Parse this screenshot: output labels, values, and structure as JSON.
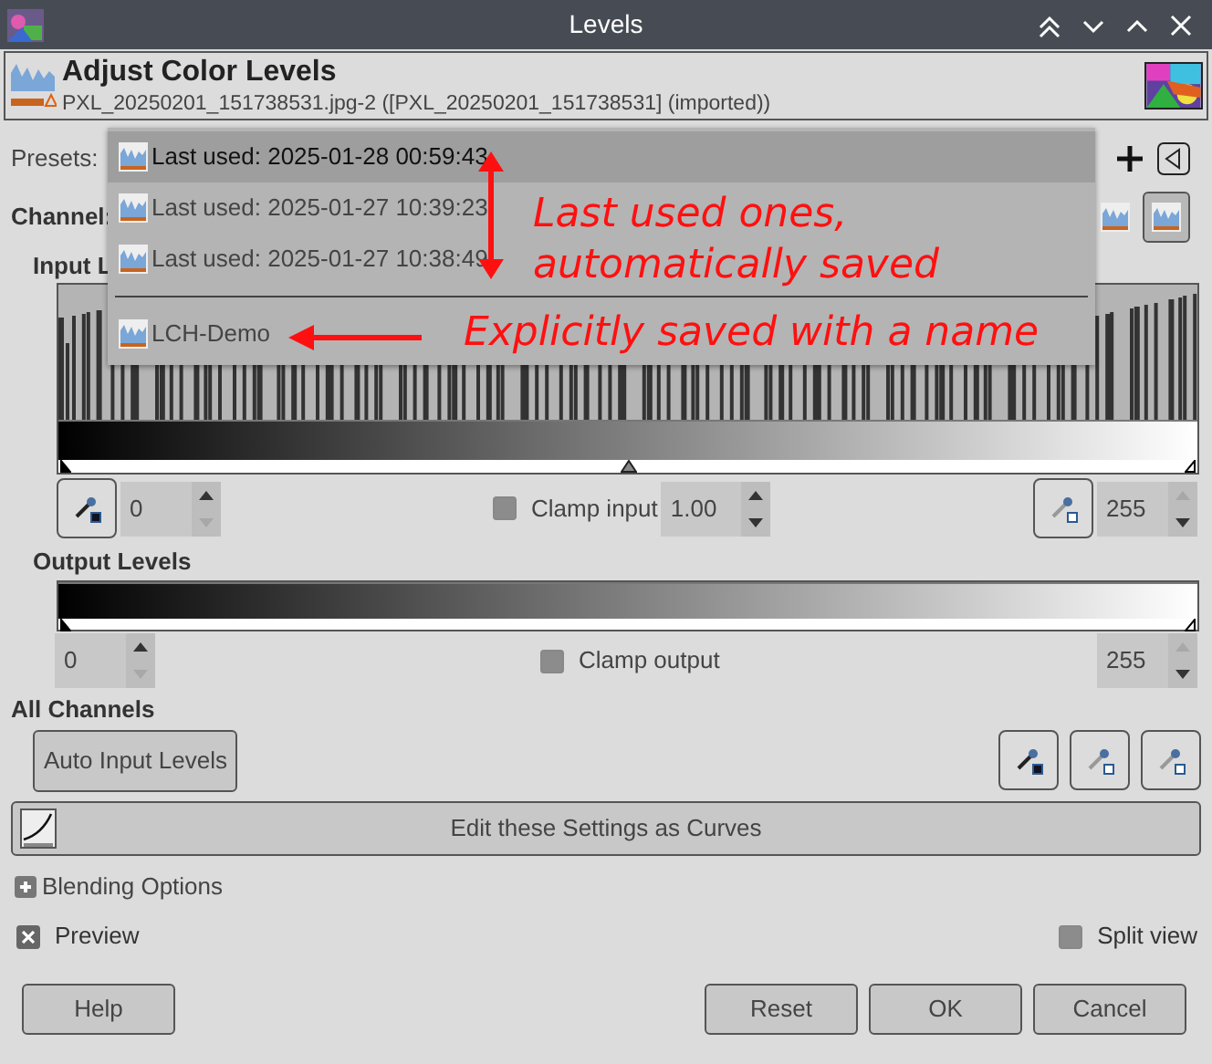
{
  "window": {
    "title": "Levels"
  },
  "header": {
    "title": "Adjust Color Levels",
    "subtitle": "PXL_20250201_151738531.jpg-2 ([PXL_20250201_151738531] (imported))"
  },
  "presets": {
    "label": "Presets:",
    "items": [
      {
        "label": "Last used: 2025-01-28 00:59:43",
        "selected": true,
        "kind": "auto"
      },
      {
        "label": "Last used: 2025-01-27 10:39:23",
        "selected": false,
        "kind": "auto"
      },
      {
        "label": "Last used: 2025-01-27 10:38:49",
        "selected": false,
        "kind": "auto"
      },
      {
        "label": "LCH-Demo",
        "selected": false,
        "kind": "named"
      }
    ]
  },
  "channel": {
    "label": "Channel:"
  },
  "input_levels": {
    "label": "Input L",
    "low": "0",
    "gamma": "1.00",
    "high": "255",
    "clamp": {
      "label": "Clamp input",
      "checked": false
    }
  },
  "output_levels": {
    "label": "Output Levels",
    "low": "0",
    "high": "255",
    "clamp": {
      "label": "Clamp output",
      "checked": false
    }
  },
  "all_channels": {
    "label": "All Channels",
    "auto_button": "Auto Input Levels"
  },
  "curves_button": "Edit these Settings as Curves",
  "blending": {
    "label": "Blending Options",
    "expanded": false
  },
  "preview": {
    "label": "Preview",
    "checked": true
  },
  "split_view": {
    "label": "Split view",
    "checked": false
  },
  "buttons": [
    "Help",
    "Reset",
    "OK",
    "Cancel"
  ],
  "annotations": [
    "Last used ones,",
    "automatically saved",
    "Explicitly saved with a name"
  ]
}
